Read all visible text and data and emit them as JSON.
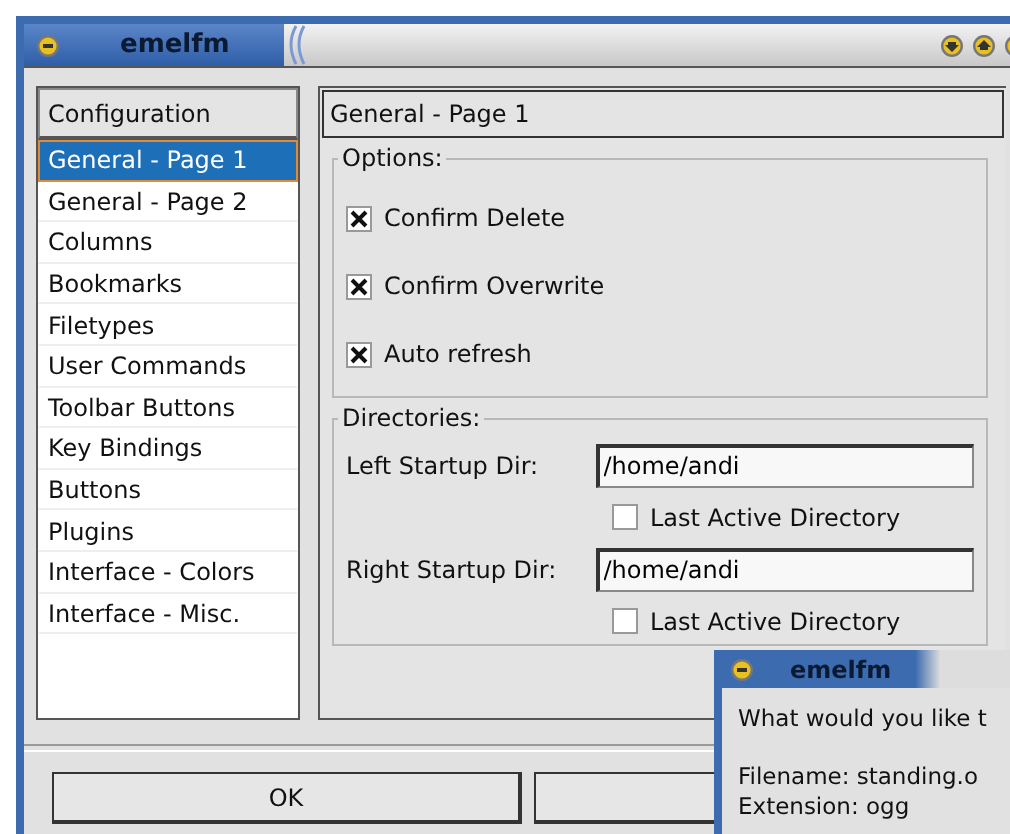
{
  "window": {
    "title": "emelfm"
  },
  "sidebar": {
    "header": "Configuration",
    "items": [
      {
        "label": "General - Page 1",
        "selected": true
      },
      {
        "label": "General - Page 2",
        "selected": false
      },
      {
        "label": "Columns",
        "selected": false
      },
      {
        "label": "Bookmarks",
        "selected": false
      },
      {
        "label": "Filetypes",
        "selected": false
      },
      {
        "label": "User Commands",
        "selected": false
      },
      {
        "label": "Toolbar Buttons",
        "selected": false
      },
      {
        "label": "Key Bindings",
        "selected": false
      },
      {
        "label": "Buttons",
        "selected": false
      },
      {
        "label": "Plugins",
        "selected": false
      },
      {
        "label": "Interface - Colors",
        "selected": false
      },
      {
        "label": "Interface - Misc.",
        "selected": false
      }
    ]
  },
  "page": {
    "title": "General - Page 1",
    "options": {
      "legend": "Options:",
      "items": [
        {
          "label": "Confirm Delete",
          "checked": true
        },
        {
          "label": "Confirm Overwrite",
          "checked": true
        },
        {
          "label": "Auto refresh",
          "checked": true
        }
      ]
    },
    "directories": {
      "legend": "Directories:",
      "rows": [
        {
          "label": "Left Startup Dir:",
          "value": "/home/andi",
          "option": {
            "label": "Last Active Directory",
            "checked": false
          }
        },
        {
          "label": "Right Startup Dir:",
          "value": "/home/andi",
          "option": {
            "label": "Last Active Directory",
            "checked": false
          }
        }
      ]
    }
  },
  "buttons": [
    {
      "kind": "text",
      "label": "OK"
    },
    {
      "kind": "blank"
    }
  ],
  "dialog": {
    "title": "emelfm",
    "lines": [
      "What would you like t",
      "Filename:  standing.o",
      "Extension: ogg"
    ]
  }
}
